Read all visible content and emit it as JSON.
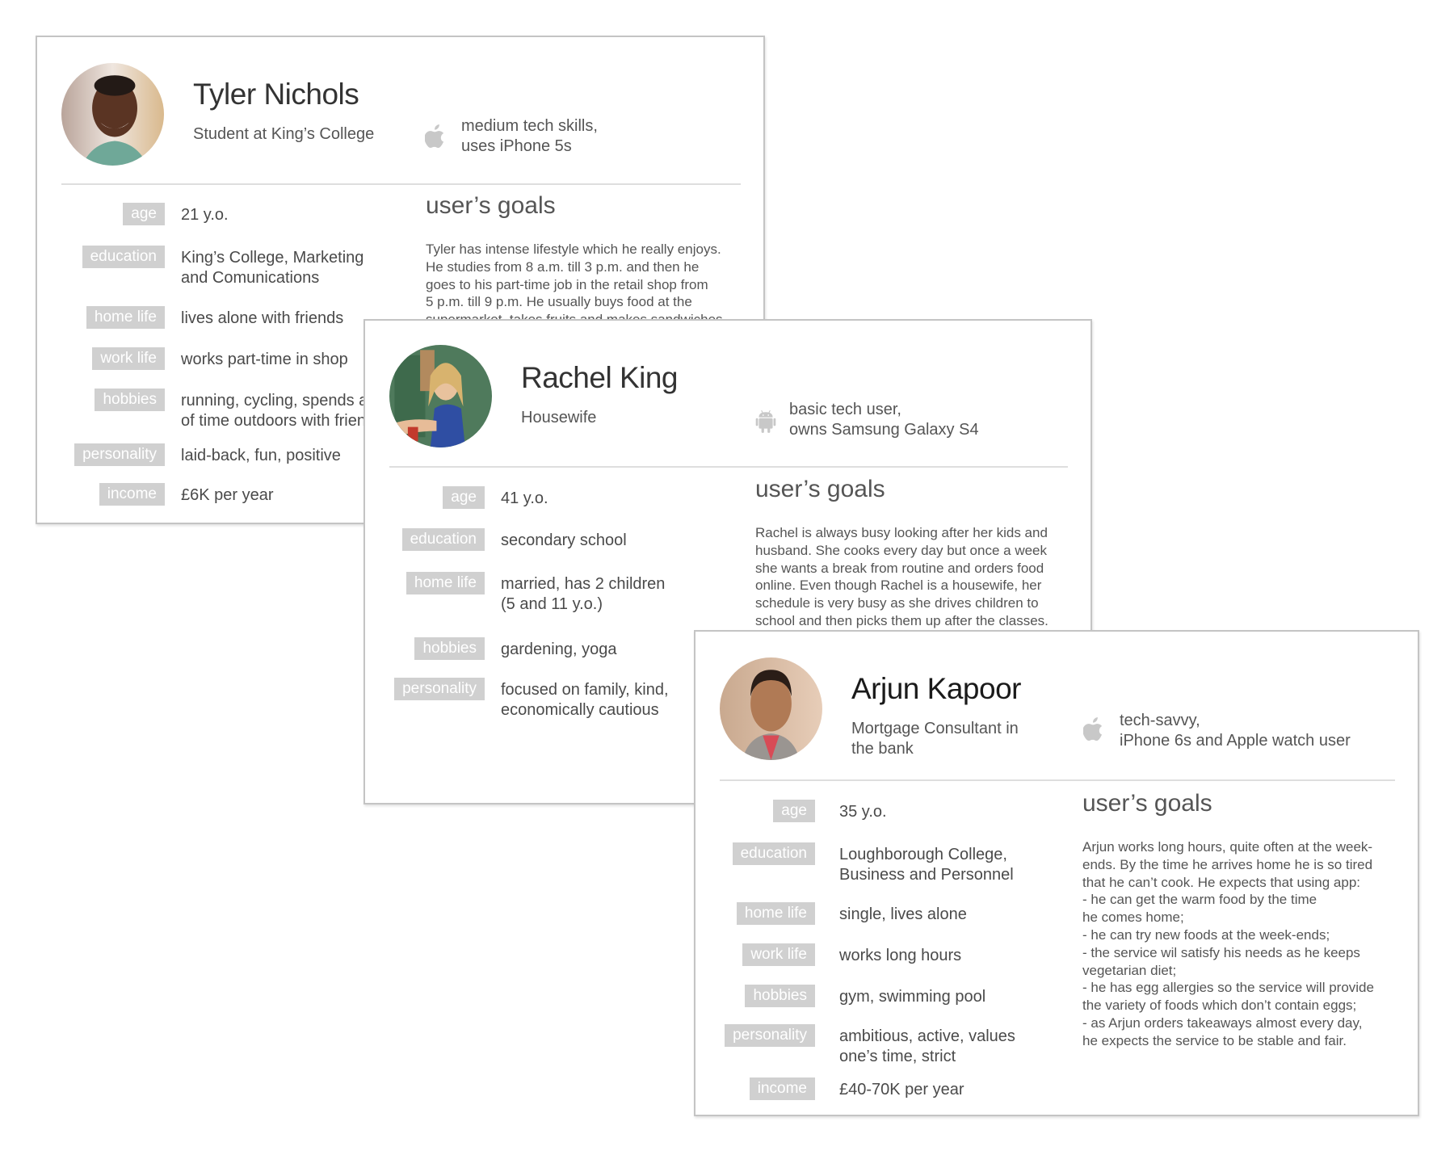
{
  "colors": {
    "label_bg": "#d0d0d0",
    "label_text": "#ffffff",
    "card_border": "#c4c4c4",
    "icon_gray": "#c8c8c8"
  },
  "personas": [
    {
      "name": "Tyler Nichols",
      "role": "Student at King’s College",
      "tech_icon": "apple-icon",
      "tech": "medium tech skills,\nuses iPhone 5s",
      "attributes": [
        {
          "label": "age",
          "value": "21 y.o."
        },
        {
          "label": "education",
          "value": "King’s College, Marketing\nand Comunications"
        },
        {
          "label": "home life",
          "value": "lives alone with friends"
        },
        {
          "label": "work life",
          "value": "works part-time in shop"
        },
        {
          "label": "hobbies",
          "value": "running, cycling, spends a lot\nof time outdoors with friends"
        },
        {
          "label": "personality",
          "value": "laid-back, fun, positive"
        },
        {
          "label": "income",
          "value": "£6K per year"
        }
      ],
      "goals_title": "user’s goals",
      "goals": "Tyler has intense lifestyle which he really enjoys.\nHe studies from 8 a.m. till 3 p.m. and then he\ngoes to his part-time job in the retail shop from\n5 p.m. till 9 p.m. He usually buys food at the\nsupermarket, takes fruits and makes sandwiches."
    },
    {
      "name": "Rachel King",
      "role": "Housewife",
      "tech_icon": "android-icon",
      "tech": "basic tech user,\nowns Samsung Galaxy S4",
      "attributes": [
        {
          "label": "age",
          "value": "41 y.o."
        },
        {
          "label": "education",
          "value": "secondary school"
        },
        {
          "label": "home life",
          "value": "married, has 2 children\n(5 and 11 y.o.)"
        },
        {
          "label": "hobbies",
          "value": "gardening, yoga"
        },
        {
          "label": "personality",
          "value": "focused on family, kind,\neconomically cautious"
        }
      ],
      "goals_title": "user’s goals",
      "goals": "Rachel is always busy looking after her kids and\nhusband. She cooks every day but once a week\nshe wants a break from routine and orders food\nonline. Even though Rachel is a housewife, her\nschedule is very busy as she drives children to\nschool and then picks them up after the classes."
    },
    {
      "name": "Arjun Kapoor",
      "role": "Mortgage Consultant in the bank",
      "tech_icon": "apple-icon",
      "tech": "tech-savvy,\niPhone 6s and Apple watch user",
      "attributes": [
        {
          "label": "age",
          "value": "35 y.o."
        },
        {
          "label": "education",
          "value": "Loughborough College,\nBusiness and Personnel"
        },
        {
          "label": "home life",
          "value": "single, lives alone"
        },
        {
          "label": "work life",
          "value": "works long hours"
        },
        {
          "label": "hobbies",
          "value": "gym, swimming pool"
        },
        {
          "label": "personality",
          "value": "ambitious, active, values\none’s time, strict"
        },
        {
          "label": "income",
          "value": "£40-70K per year"
        }
      ],
      "goals_title": "user’s goals",
      "goals": "Arjun works long hours, quite often at the week-\nends. By the time he arrives home he is so tired\nthat he can’t cook. He expects that using app:\n- he can get the warm food by the time\nhe comes home;\n- he can try new foods at the week-ends;\n- the service wil satisfy his needs as he keeps\nvegetarian diet;\n- he has egg allergies so the service will provide\n the variety of foods which don’t contain eggs;\n- as Arjun orders takeaways almost every day,\nhe expects the service to be stable and fair."
    }
  ]
}
